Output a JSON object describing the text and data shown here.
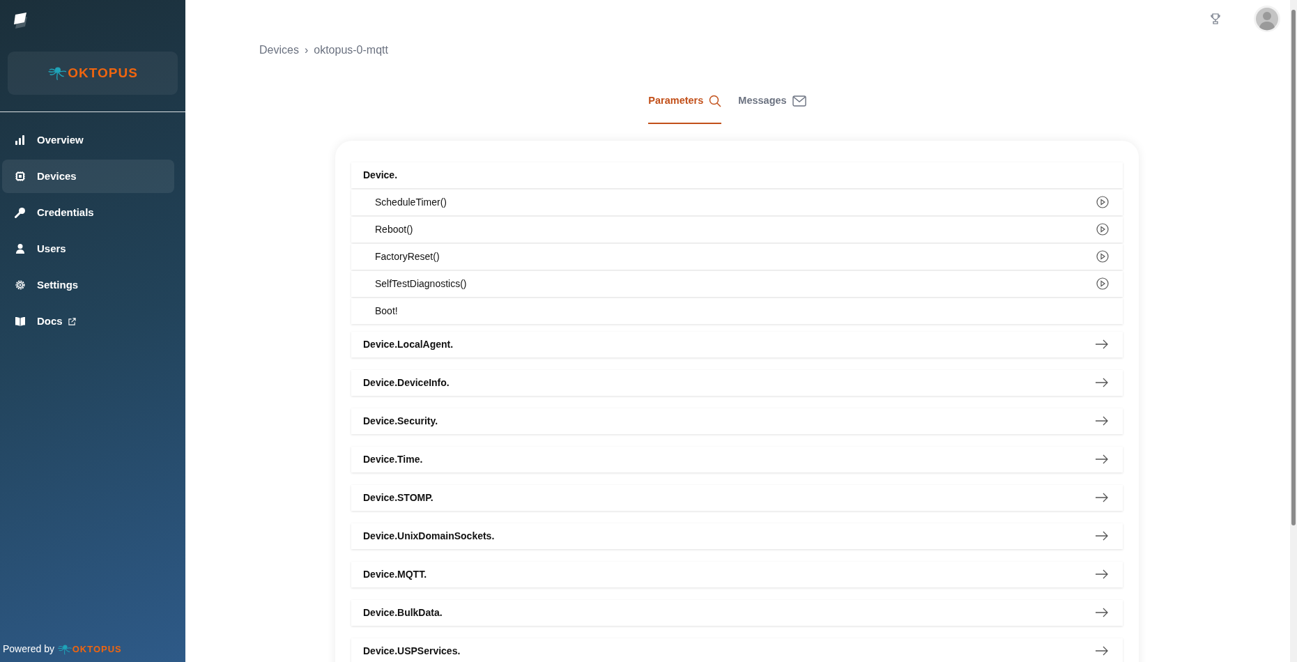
{
  "sidebar": {
    "brand": "OKTOPUS",
    "items": [
      {
        "label": "Overview",
        "selected": false,
        "external": false
      },
      {
        "label": "Devices",
        "selected": true,
        "external": false
      },
      {
        "label": "Credentials",
        "selected": false,
        "external": false
      },
      {
        "label": "Users",
        "selected": false,
        "external": false
      },
      {
        "label": "Settings",
        "selected": false,
        "external": false
      },
      {
        "label": "Docs",
        "selected": false,
        "external": true
      }
    ],
    "footer": {
      "text": "Powered by",
      "brand": "OKTOPUS"
    }
  },
  "breadcrumb": [
    {
      "label": "Devices"
    },
    {
      "label": "›"
    },
    {
      "label": "oktopus-0-mqtt"
    }
  ],
  "tabs": [
    {
      "label": "Parameters",
      "selected": true
    },
    {
      "label": "Messages",
      "selected": false
    }
  ],
  "objects": [
    {
      "name": "Device.",
      "expanded": true,
      "children": [
        {
          "name": "ScheduleTimer()",
          "kind": "command"
        },
        {
          "name": "Reboot()",
          "kind": "command"
        },
        {
          "name": "FactoryReset()",
          "kind": "command"
        },
        {
          "name": "SelfTestDiagnostics()",
          "kind": "command"
        },
        {
          "name": "Boot!",
          "kind": "event"
        }
      ]
    },
    {
      "name": "Device.LocalAgent.",
      "expanded": false
    },
    {
      "name": "Device.DeviceInfo.",
      "expanded": false
    },
    {
      "name": "Device.Security.",
      "expanded": false
    },
    {
      "name": "Device.Time.",
      "expanded": false
    },
    {
      "name": "Device.STOMP.",
      "expanded": false
    },
    {
      "name": "Device.UnixDomainSockets.",
      "expanded": false
    },
    {
      "name": "Device.MQTT.",
      "expanded": false
    },
    {
      "name": "Device.BulkData.",
      "expanded": false
    },
    {
      "name": "Device.USPServices.",
      "expanded": false
    }
  ]
}
